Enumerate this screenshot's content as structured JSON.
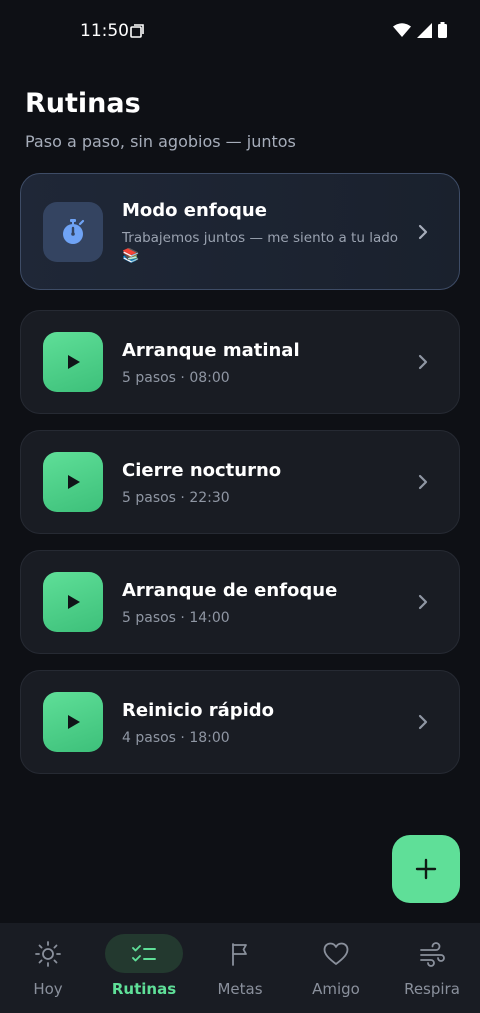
{
  "status_bar": {
    "time": "11:50"
  },
  "header": {
    "title": "Rutinas",
    "subtitle": "Paso a paso, sin agobios — juntos"
  },
  "focus_card": {
    "title": "Modo enfoque",
    "subtitle": "Trabajemos juntos — me siento a tu lado",
    "emoji": "📚",
    "icon": "stopwatch-icon"
  },
  "routines": [
    {
      "title": "Arranque matinal",
      "subtitle": "5 pasos · 08:00"
    },
    {
      "title": "Cierre nocturno",
      "subtitle": "5 pasos · 22:30"
    },
    {
      "title": "Arranque de enfoque",
      "subtitle": "5 pasos · 14:00"
    },
    {
      "title": "Reinicio rápido",
      "subtitle": "4 pasos · 18:00"
    }
  ],
  "fab": {
    "icon": "plus-icon"
  },
  "nav": [
    {
      "label": "Hoy",
      "icon": "sun-icon",
      "active": false
    },
    {
      "label": "Rutinas",
      "icon": "checklist-icon",
      "active": true
    },
    {
      "label": "Metas",
      "icon": "flag-icon",
      "active": false
    },
    {
      "label": "Amigo",
      "icon": "heart-icon",
      "active": false
    },
    {
      "label": "Respira",
      "icon": "wind-icon",
      "active": false
    }
  ],
  "colors": {
    "background": "#0e1015",
    "card": "#191c23",
    "accent_green": "#5fdf98",
    "focus_icon_bg": "#344461",
    "focus_icon": "#6fa3f5",
    "nav_active_bg": "#23392f"
  }
}
